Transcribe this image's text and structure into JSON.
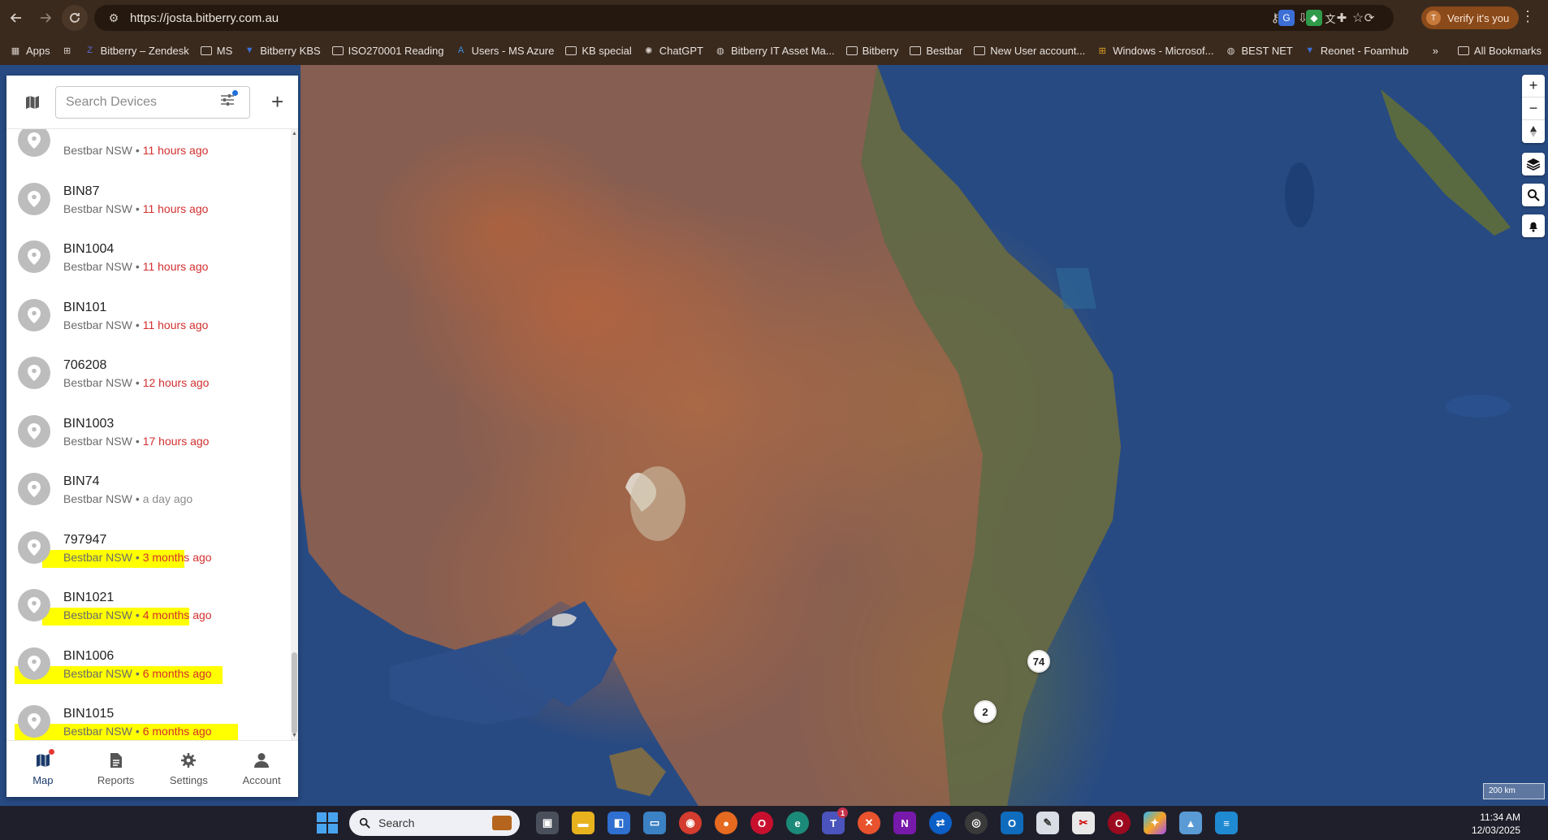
{
  "browser": {
    "url": "https://josta.bitberry.com.au",
    "verify_label": "Verify it's you",
    "avatar_letter": "T"
  },
  "bookmarks": [
    {
      "label": "Apps",
      "icon": "apps-grid-icon"
    },
    {
      "label": "",
      "icon": "grid-icon"
    },
    {
      "label": "Bitberry – Zendesk",
      "icon": "zendesk-icon"
    },
    {
      "label": "MS",
      "icon": "folder-icon"
    },
    {
      "label": "Bitberry KBS",
      "icon": "bookmark-icon"
    },
    {
      "label": "ISO270001 Reading",
      "icon": "folder-icon"
    },
    {
      "label": "Users - MS Azure",
      "icon": "azure-icon"
    },
    {
      "label": "KB special",
      "icon": "folder-icon"
    },
    {
      "label": "ChatGPT",
      "icon": "chatgpt-icon"
    },
    {
      "label": "Bitberry IT Asset Ma...",
      "icon": "globe-icon"
    },
    {
      "label": "Bitberry",
      "icon": "folder-icon"
    },
    {
      "label": "Bestbar",
      "icon": "folder-icon"
    },
    {
      "label": "New User account...",
      "icon": "folder-icon"
    },
    {
      "label": "Windows - Microsof...",
      "icon": "windows-icon"
    },
    {
      "label": "BEST NET",
      "icon": "globe-icon"
    },
    {
      "label": "Reonet - Foamhub",
      "icon": "bookmark-icon"
    }
  ],
  "bookmarks_right": {
    "overflow": "»",
    "all_bookmarks": "All Bookmarks"
  },
  "panel": {
    "search_placeholder": "Search Devices",
    "add_symbol": "+"
  },
  "devices": [
    {
      "name": "",
      "group": "Bestbar NSW",
      "time": "11 hours ago",
      "status": "recent",
      "highlighted": false
    },
    {
      "name": "BIN87",
      "group": "Bestbar NSW",
      "time": "11 hours ago",
      "status": "recent",
      "highlighted": false
    },
    {
      "name": "BIN1004",
      "group": "Bestbar NSW",
      "time": "11 hours ago",
      "status": "recent",
      "highlighted": false
    },
    {
      "name": "BIN101",
      "group": "Bestbar NSW",
      "time": "11 hours ago",
      "status": "recent",
      "highlighted": false
    },
    {
      "name": "706208",
      "group": "Bestbar NSW",
      "time": "12 hours ago",
      "status": "recent",
      "highlighted": false
    },
    {
      "name": "BIN1003",
      "group": "Bestbar NSW",
      "time": "17 hours ago",
      "status": "recent",
      "highlighted": false
    },
    {
      "name": "BIN74",
      "group": "Bestbar NSW",
      "time": "a day ago",
      "status": "old",
      "highlighted": false
    },
    {
      "name": "797947",
      "group": "Bestbar NSW",
      "time": "3 months ago",
      "status": "recent",
      "highlighted": true
    },
    {
      "name": "BIN1021",
      "group": "Bestbar NSW",
      "time": "4 months ago",
      "status": "recent",
      "highlighted": true
    },
    {
      "name": "BIN1006",
      "group": "Bestbar NSW",
      "time": "6 months ago",
      "status": "recent",
      "highlighted": true
    },
    {
      "name": "BIN1015",
      "group": "Bestbar NSW",
      "time": "6 months ago",
      "status": "recent",
      "highlighted": true
    }
  ],
  "separator": "•",
  "nav": [
    {
      "label": "Map",
      "icon": "map-icon",
      "active": true
    },
    {
      "label": "Reports",
      "icon": "report-icon",
      "active": false
    },
    {
      "label": "Settings",
      "icon": "gear-icon",
      "active": false
    },
    {
      "label": "Account",
      "icon": "person-icon",
      "active": false
    }
  ],
  "map": {
    "clusters": [
      "74",
      "2"
    ],
    "scale_label": "200 km",
    "controls": {
      "zoom_in": "+",
      "zoom_out": "−"
    }
  },
  "taskbar": {
    "search_label": "Search",
    "time": "11:34 AM",
    "date": "12/03/2025",
    "teams_badge": "1"
  },
  "colors": {
    "recent_time": "#d32f2f",
    "old_time": "#8d8d8d",
    "highlight": "#ffff00",
    "nav_active": "#1b3a6b",
    "ocean": "#274a82"
  }
}
